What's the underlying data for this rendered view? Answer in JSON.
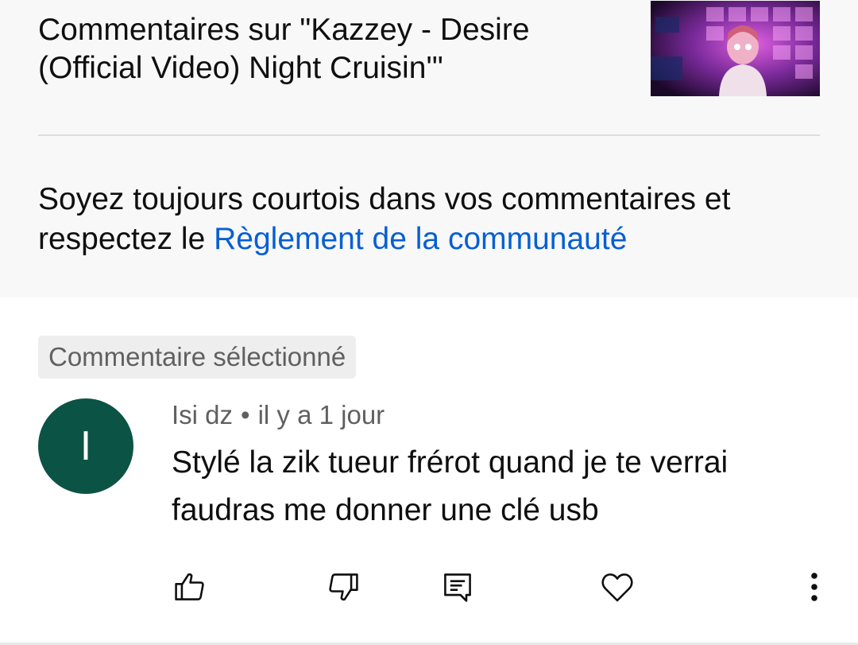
{
  "header": {
    "title_line1": "Commentaires sur \"Kazzey - Desire",
    "title_line2": "(Official Video) Night Cruisin'\"",
    "guidelines_prefix": "Soyez toujours courtois dans vos commentaires et respectez le ",
    "guidelines_link": "Règlement de la communauté"
  },
  "selected_label": "Commentaire sélectionné",
  "comment": {
    "avatar_initial": "I",
    "avatar_color": "#0b5345",
    "author": "Isi dz",
    "separator": "•",
    "time": "il y a 1 jour",
    "text": "Stylé la zik tueur frérot quand je te verrai faudras me donner une clé usb"
  },
  "actions": [
    {
      "icon": "thumb-up-icon"
    },
    {
      "icon": "thumb-down-icon"
    },
    {
      "icon": "reply-icon"
    },
    {
      "icon": "heart-icon"
    },
    {
      "icon": "more-vert-icon"
    }
  ],
  "colors": {
    "link": "#065fd4",
    "header_bg": "#f8f8f8",
    "secondary_text": "#606060"
  }
}
